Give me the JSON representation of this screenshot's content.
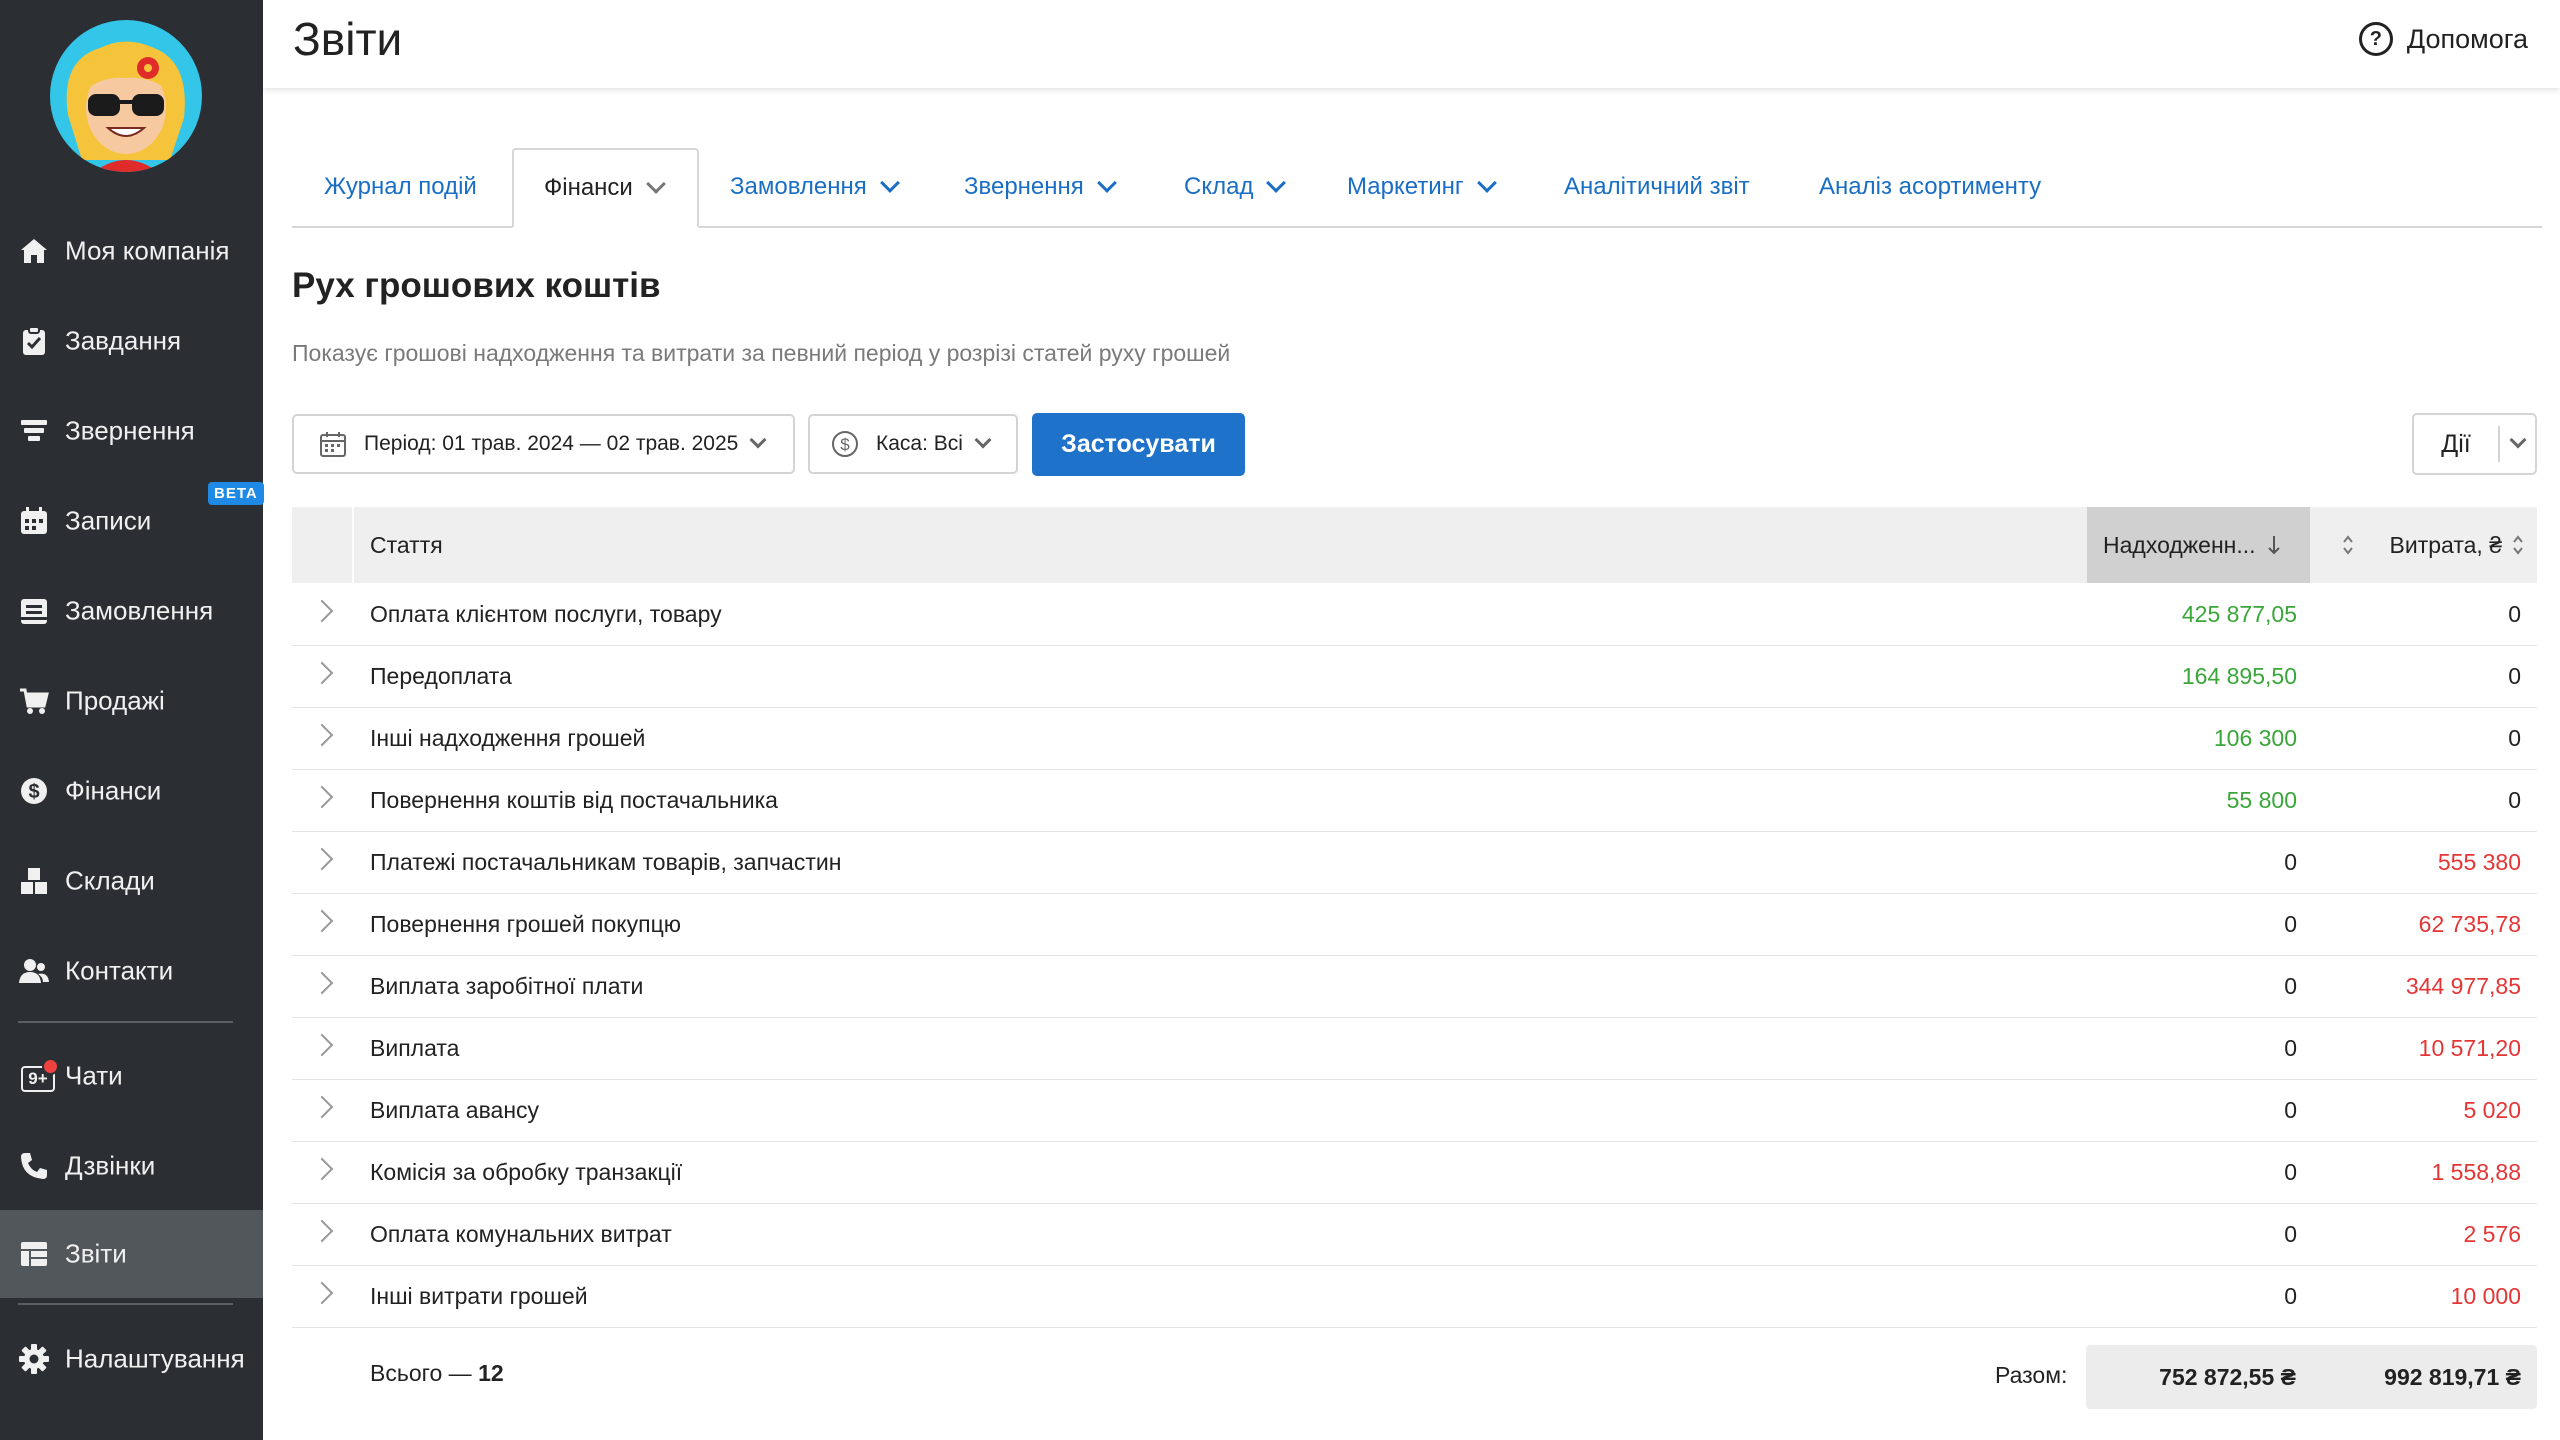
{
  "sidebar": {
    "items": [
      {
        "label": "Моя компанія",
        "icon": "home-icon"
      },
      {
        "label": "Завдання",
        "icon": "clipboard-icon"
      },
      {
        "label": "Звернення",
        "icon": "funnel-icon"
      },
      {
        "label": "Записи",
        "icon": "calendar-icon",
        "badge": "BETA"
      },
      {
        "label": "Замовлення",
        "icon": "order-icon"
      },
      {
        "label": "Продажі",
        "icon": "cart-icon"
      },
      {
        "label": "Фінанси",
        "icon": "dollar-icon"
      },
      {
        "label": "Склади",
        "icon": "boxes-icon"
      },
      {
        "label": "Контакти",
        "icon": "contacts-icon"
      },
      {
        "label": "Чати",
        "icon": "chat-icon",
        "counter": "9+"
      },
      {
        "label": "Дзвінки",
        "icon": "phone-icon"
      },
      {
        "label": "Звіти",
        "icon": "reports-icon",
        "active": true
      },
      {
        "label": "Налаштування",
        "icon": "gear-icon"
      }
    ]
  },
  "header": {
    "title": "Звіти",
    "help_label": "Допомога"
  },
  "tabs": [
    {
      "label": "Журнал подій"
    },
    {
      "label": "Фінанси",
      "active": true
    },
    {
      "label": "Замовлення"
    },
    {
      "label": "Звернення"
    },
    {
      "label": "Склад"
    },
    {
      "label": "Маркетинг"
    },
    {
      "label": "Аналітичний звіт"
    },
    {
      "label": "Аналіз асортименту"
    }
  ],
  "report": {
    "title": "Рух грошових коштів",
    "description": "Показує грошові надходження та витрати за певний період у розрізі статей руху грошей"
  },
  "filters": {
    "period": "Період: 01 трав. 2024 — 02 трав. 2025",
    "cash": "Каса: Всі",
    "apply_label": "Застосувати",
    "actions_label": "Дії"
  },
  "table": {
    "columns": {
      "article": "Стаття",
      "income": "Надходженн...",
      "expense": "Витрата, ₴"
    },
    "rows": [
      {
        "name": "Оплата клієнтом послуги, товару",
        "income": "425 877,05",
        "expense": "0"
      },
      {
        "name": "Передоплата",
        "income": "164 895,50",
        "expense": "0"
      },
      {
        "name": "Інші надходження грошей",
        "income": "106 300",
        "expense": "0"
      },
      {
        "name": "Повернення коштів від постачальника",
        "income": "55 800",
        "expense": "0"
      },
      {
        "name": "Платежі постачальникам товарів, запчастин",
        "income": "0",
        "expense": "555 380"
      },
      {
        "name": "Повернення грошей покупцю",
        "income": "0",
        "expense": "62 735,78"
      },
      {
        "name": "Виплата заробітної плати",
        "income": "0",
        "expense": "344 977,85"
      },
      {
        "name": "Виплата",
        "income": "0",
        "expense": "10 571,20"
      },
      {
        "name": "Виплата авансу",
        "income": "0",
        "expense": "5 020"
      },
      {
        "name": "Комісія за обробку транзакції",
        "income": "0",
        "expense": "1 558,88"
      },
      {
        "name": "Оплата комунальних витрат",
        "income": "0",
        "expense": "2 576"
      },
      {
        "name": "Інші витрати грошей",
        "income": "0",
        "expense": "10 000"
      }
    ],
    "footer": {
      "total_prefix": "Всього — ",
      "total_count": "12",
      "sum_label": "Разом:",
      "sum_income": "752 872,55 ₴",
      "sum_expense": "992 819,71 ₴"
    }
  },
  "colors": {
    "sidebar_bg": "#2b2f33",
    "active_nav": "#52575c",
    "accent": "#1f72c9",
    "income": "#3aa63a",
    "expense": "#e53535"
  }
}
